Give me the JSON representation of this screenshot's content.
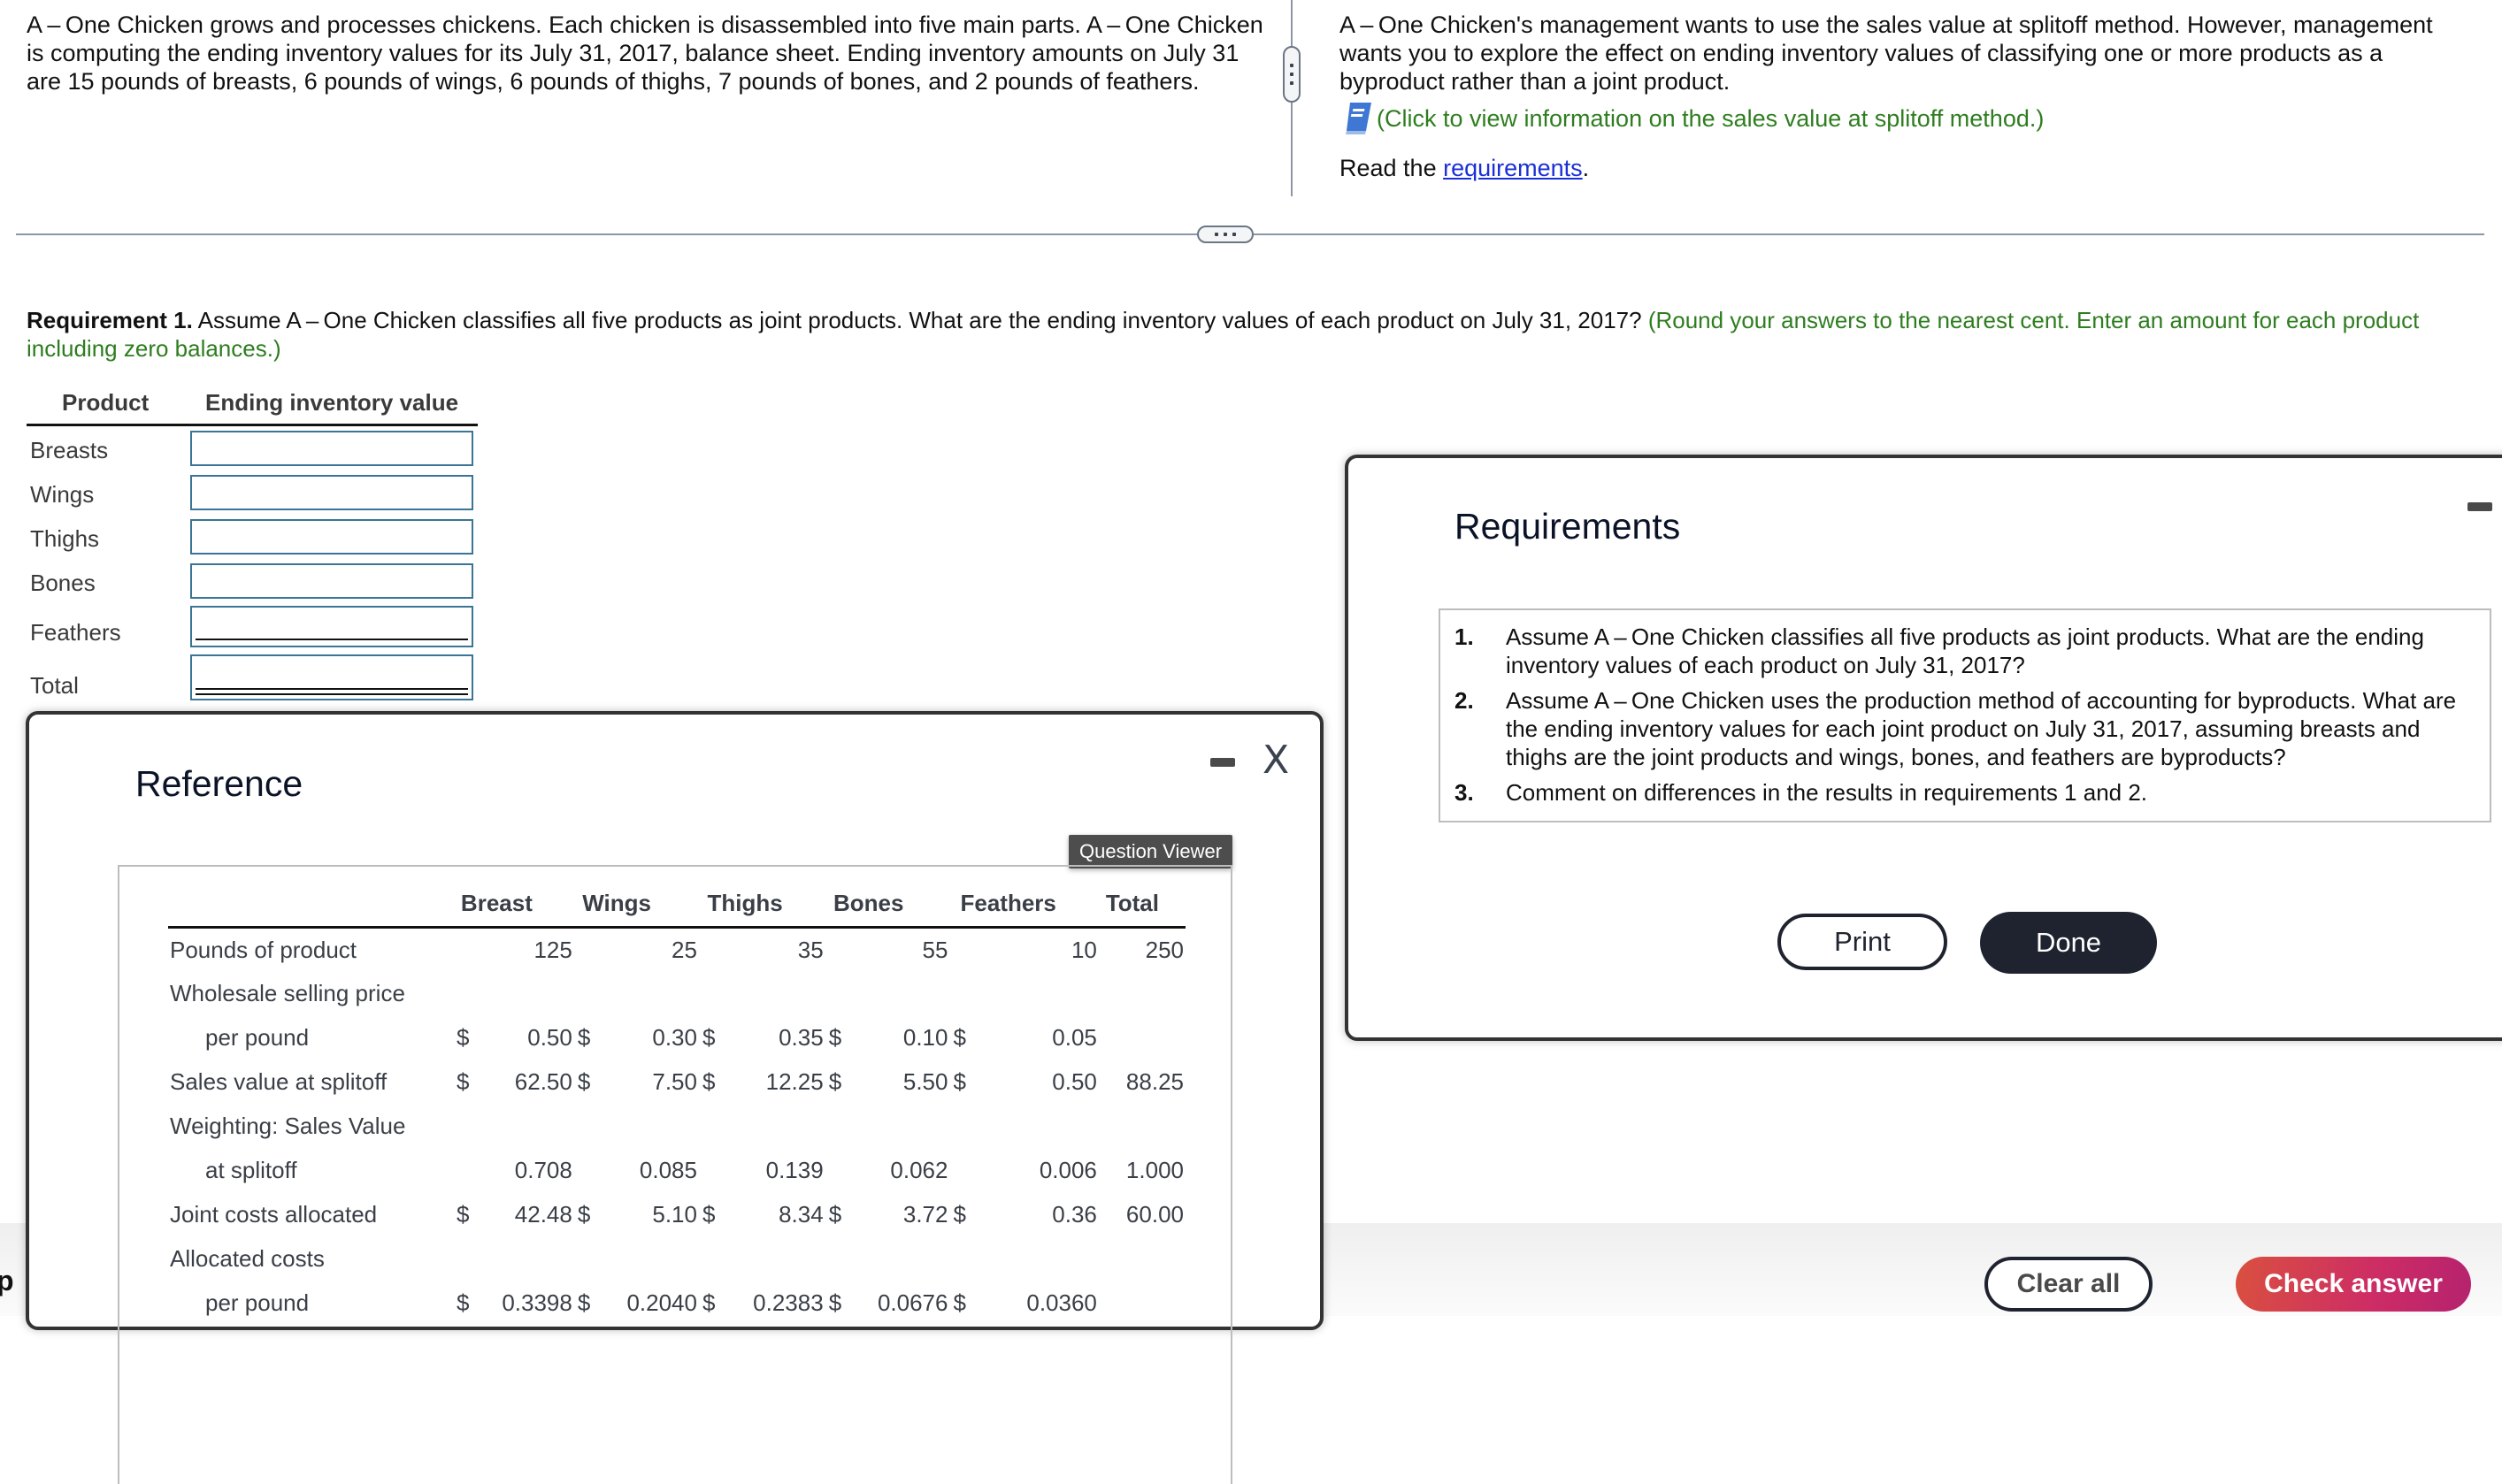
{
  "problem": {
    "left_text": "A – One Chicken grows and processes chickens. Each chicken is disassembled into five main parts. A – One Chicken is computing the ending inventory values for its July 31, 2017, balance sheet. Ending inventory amounts on July 31 are 15 pounds of breasts, 6 pounds of wings, 6 pounds of thighs, 7 pounds of bones, and 2 pounds of feathers.",
    "right_text": "A – One Chicken's management wants to use the sales value at splitoff method. However, management wants you to explore the effect on ending inventory values of classifying one or more products as a byproduct rather than a joint product.",
    "info_link": "(Click to view information on the sales value at splitoff method.)",
    "read_prefix": "Read the ",
    "read_link": "requirements",
    "read_suffix": "."
  },
  "requirement1": {
    "label": "Requirement 1.",
    "text": " Assume A – One Chicken classifies all five products as joint products. What are the ending inventory values of each product on July 31, 2017? ",
    "hint": "(Round your answers to the nearest cent. Enter an amount for each product including zero balances.)"
  },
  "answer_table": {
    "headers": [
      "Product",
      "Ending inventory value"
    ],
    "rows": [
      {
        "label": "Breasts",
        "value": ""
      },
      {
        "label": "Wings",
        "value": ""
      },
      {
        "label": "Thighs",
        "value": ""
      },
      {
        "label": "Bones",
        "value": ""
      },
      {
        "label": "Feathers",
        "value": ""
      },
      {
        "label": "Total",
        "value": ""
      }
    ]
  },
  "reference_modal": {
    "title": "Reference",
    "tooltip": "Question Viewer",
    "columns": [
      "Breast",
      "Wings",
      "Thighs",
      "Bones",
      "Feathers",
      "Total"
    ],
    "rows": [
      {
        "label": "Pounds of product",
        "values": [
          "125",
          "25",
          "35",
          "55",
          "10",
          "250"
        ],
        "dollar": false
      },
      {
        "label": "Wholesale selling price",
        "values": [
          "",
          "",
          "",
          "",
          "",
          ""
        ],
        "dollar": false
      },
      {
        "label": "per pound",
        "indent": true,
        "values": [
          "0.50",
          "0.30",
          "0.35",
          "0.10",
          "0.05",
          ""
        ],
        "dollar": true
      },
      {
        "label": "Sales value at splitoff",
        "values": [
          "62.50",
          "7.50",
          "12.25",
          "5.50",
          "0.50",
          "88.25"
        ],
        "dollar": true
      },
      {
        "label": "Weighting: Sales Value",
        "values": [
          "",
          "",
          "",
          "",
          "",
          ""
        ],
        "dollar": false
      },
      {
        "label": "at splitoff",
        "indent": true,
        "values": [
          "0.708",
          "0.085",
          "0.139",
          "0.062",
          "0.006",
          "1.000"
        ],
        "dollar": false
      },
      {
        "label": "Joint costs allocated",
        "values": [
          "42.48",
          "5.10",
          "8.34",
          "3.72",
          "0.36",
          "60.00"
        ],
        "dollar": true
      },
      {
        "label": "Allocated costs",
        "values": [
          "",
          "",
          "",
          "",
          "",
          ""
        ],
        "dollar": false
      },
      {
        "label": "per pound",
        "indent": true,
        "values": [
          "0.3398",
          "0.2040",
          "0.2383",
          "0.0676",
          "0.0360",
          ""
        ],
        "dollar": true
      }
    ]
  },
  "requirements_modal": {
    "title": "Requirements",
    "items": [
      {
        "num": "1.",
        "text": "Assume A – One Chicken classifies all five products as joint products. What are the ending inventory values of each product on July 31, 2017?"
      },
      {
        "num": "2.",
        "text": "Assume A – One Chicken uses the production method of accounting for byproducts. What are the ending inventory values for each joint product on July 31, 2017, assuming breasts and thighs are the joint products and wings, bones, and feathers are byproducts?"
      },
      {
        "num": "3.",
        "text": "Comment on differences in the results in requirements 1 and 2."
      }
    ],
    "print_label": "Print",
    "done_label": "Done"
  },
  "footer": {
    "left_fragment": "p",
    "clear_label": "Clear all",
    "check_label": "Check answer"
  },
  "icons": {
    "close": "X"
  }
}
